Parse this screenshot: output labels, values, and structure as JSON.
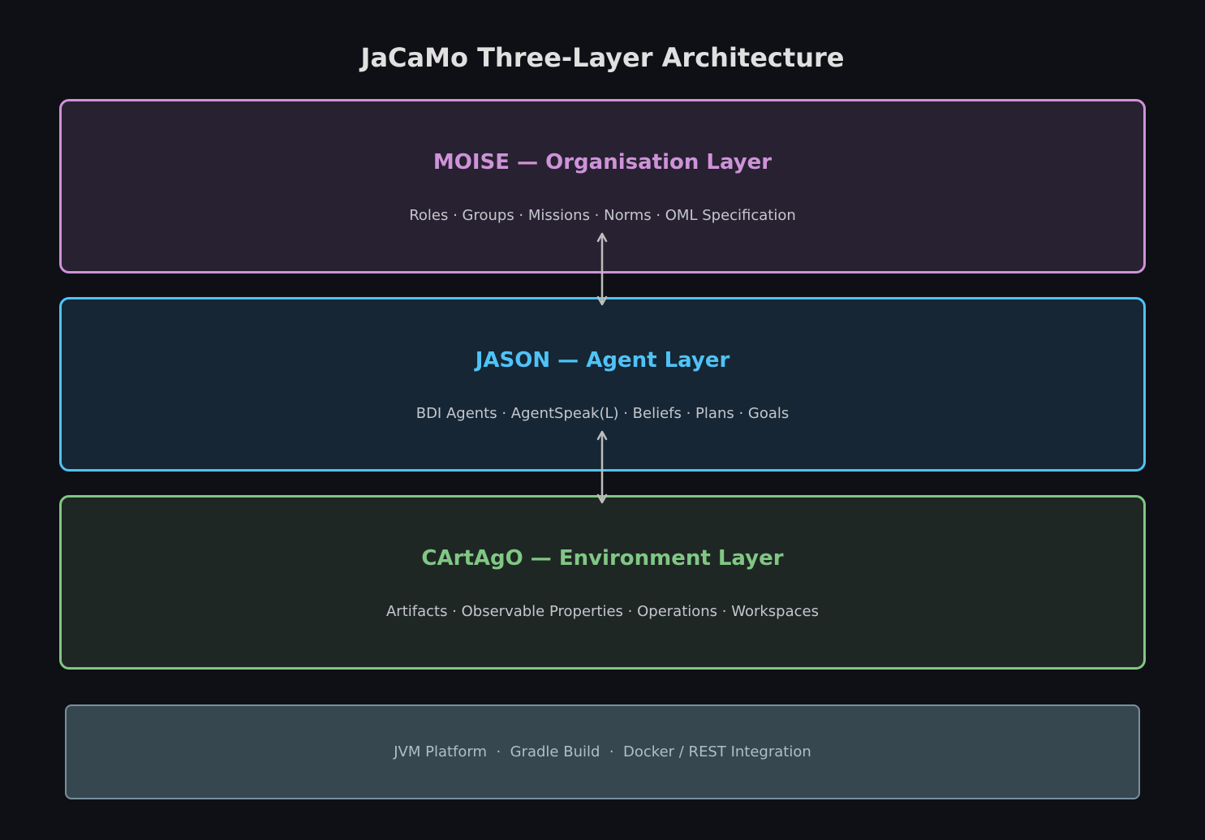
{
  "title": "JaCaMo Three-Layer Architecture",
  "layers": [
    {
      "title": "MOISE — Organisation Layer",
      "subtitle": "Roles · Groups · Missions · Norms · OML Specification",
      "color": "#ce93d8"
    },
    {
      "title": "JASON — Agent Layer",
      "subtitle": "BDI Agents · AgentSpeak(L) · Beliefs · Plans · Goals",
      "color": "#4fc3f7"
    },
    {
      "title": "CArtAgO — Environment Layer",
      "subtitle": "Artifacts · Observable Properties · Operations · Workspaces",
      "color": "#81c784"
    }
  ],
  "platform": {
    "text": "JVM Platform  ·  Gradle Build  ·  Docker / REST Integration"
  },
  "connectors": [
    {
      "from": "MOISE — Organisation Layer",
      "to": "JASON — Agent Layer",
      "direction": "bidirectional"
    },
    {
      "from": "JASON — Agent Layer",
      "to": "CArtAgO — Environment Layer",
      "direction": "bidirectional"
    }
  ]
}
